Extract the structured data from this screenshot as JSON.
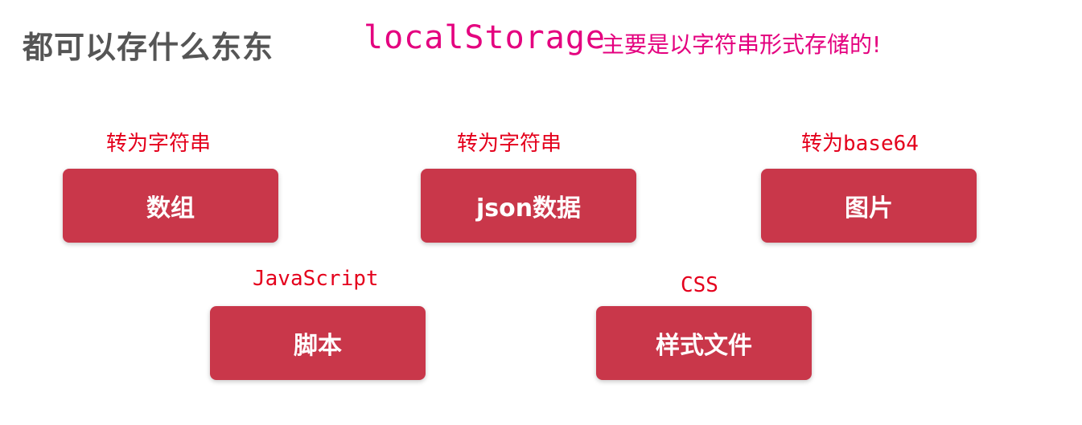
{
  "header": {
    "heading": "都可以存什么东东",
    "keyword": "localStorage",
    "note": "主要是以字符串形式存储的!"
  },
  "items": [
    {
      "label": "转为字符串",
      "card": "数组"
    },
    {
      "label": "转为字符串",
      "card": "json数据"
    },
    {
      "label": "转为base64",
      "card": "图片"
    },
    {
      "label": "JavaScript",
      "card": "脚本"
    },
    {
      "label": "CSS",
      "card": "样式文件"
    }
  ]
}
